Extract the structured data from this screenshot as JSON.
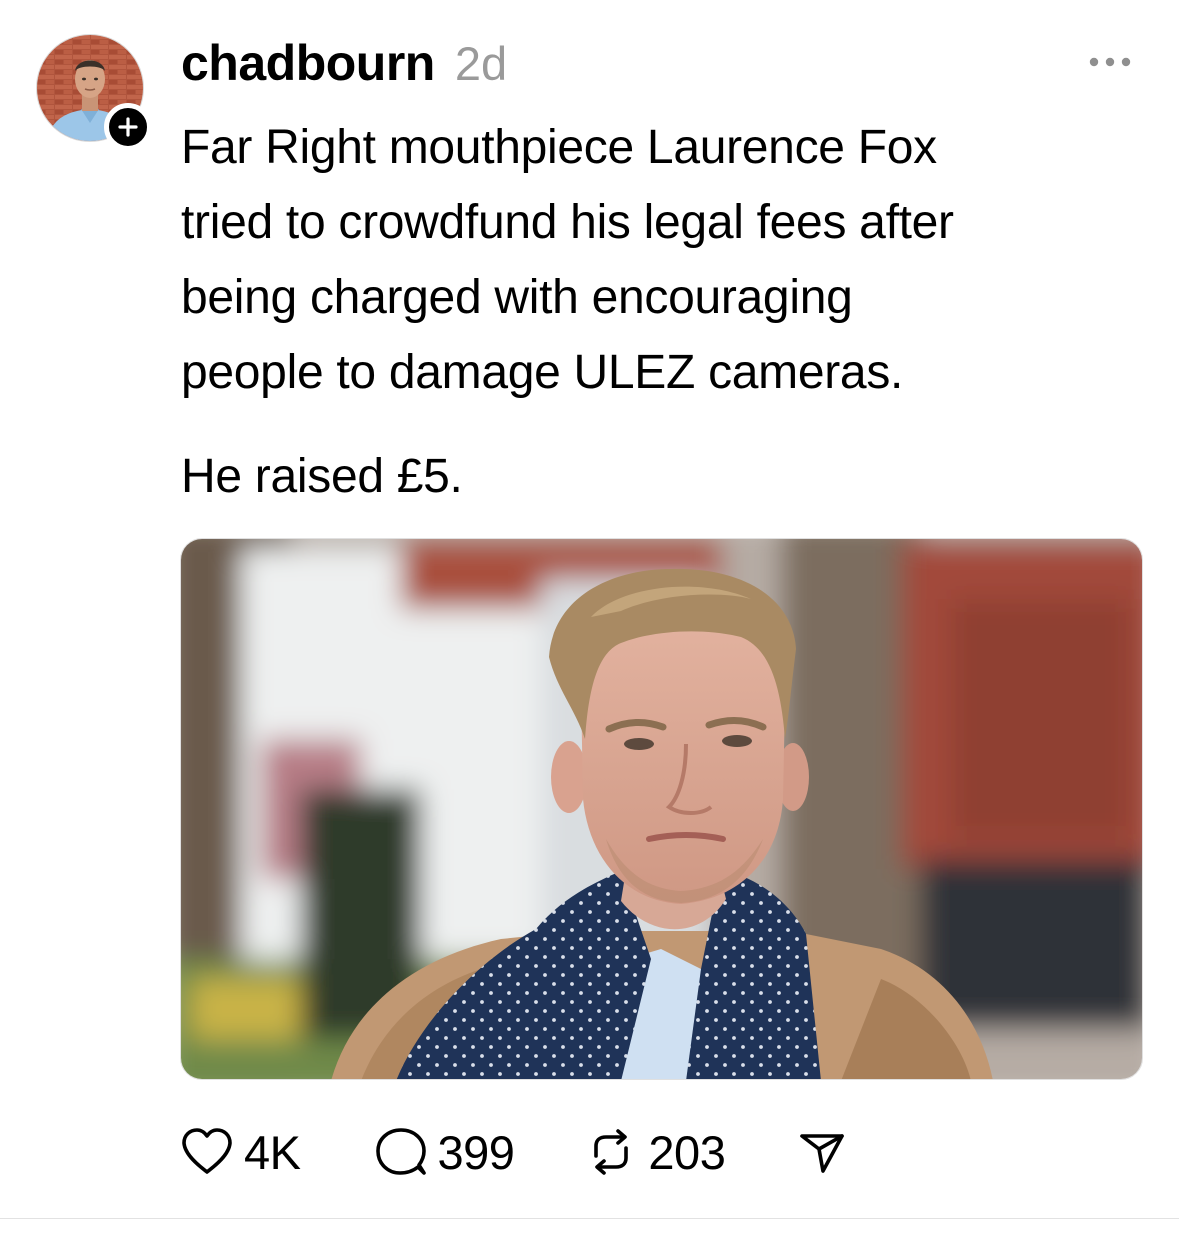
{
  "post": {
    "author": {
      "username": "chadbourn",
      "timestamp": "2d"
    },
    "text_lines": [
      "Far Right mouthpiece Laurence Fox",
      "tried to crowdfund his legal fees after",
      "being charged with encouraging",
      "people to damage ULEZ cameras."
    ],
    "text_second_paragraph": "He raised £5.",
    "media": {
      "type": "photo"
    },
    "actions": {
      "likes": "4K",
      "replies": "399",
      "reposts": "203"
    }
  },
  "icons": {
    "follow": "plus-icon",
    "more": "more-horizontal-icon",
    "like": "heart-icon",
    "reply": "speech-bubble-icon",
    "repost": "repost-icon",
    "share": "send-icon"
  },
  "colors": {
    "text": "#000000",
    "muted": "#9a9a9a",
    "divider": "#e2e2e2"
  }
}
